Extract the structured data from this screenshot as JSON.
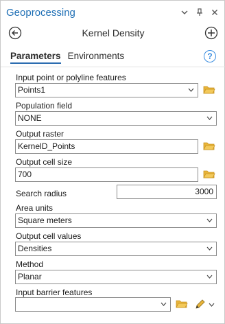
{
  "window": {
    "title": "Geoprocessing"
  },
  "tool": {
    "title": "Kernel Density"
  },
  "tabs": [
    {
      "label": "Parameters",
      "active": true
    },
    {
      "label": "Environments",
      "active": false
    }
  ],
  "icons": {
    "close": "✕",
    "pin": "⊞",
    "menu_chevron": "⌄",
    "help": "?",
    "dropdown": "⌄",
    "dropdown_small": "▾"
  },
  "params": {
    "input_features": {
      "label": "Input point or polyline features",
      "value": "Points1"
    },
    "population_field": {
      "label": "Population field",
      "value": "NONE"
    },
    "output_raster": {
      "label": "Output raster",
      "value": "KernelD_Points"
    },
    "cell_size": {
      "label": "Output cell size",
      "value": "700"
    },
    "search_radius": {
      "label": "Search radius",
      "value": "3000"
    },
    "area_units": {
      "label": "Area units",
      "value": "Square meters"
    },
    "cell_values": {
      "label": "Output cell values",
      "value": "Densities"
    },
    "method": {
      "label": "Method",
      "value": "Planar"
    },
    "barriers": {
      "label": "Input barrier features",
      "value": ""
    }
  },
  "colors": {
    "accent": "#1f6fb5",
    "folder": "#e8b43a",
    "help": "#3a8de0"
  }
}
